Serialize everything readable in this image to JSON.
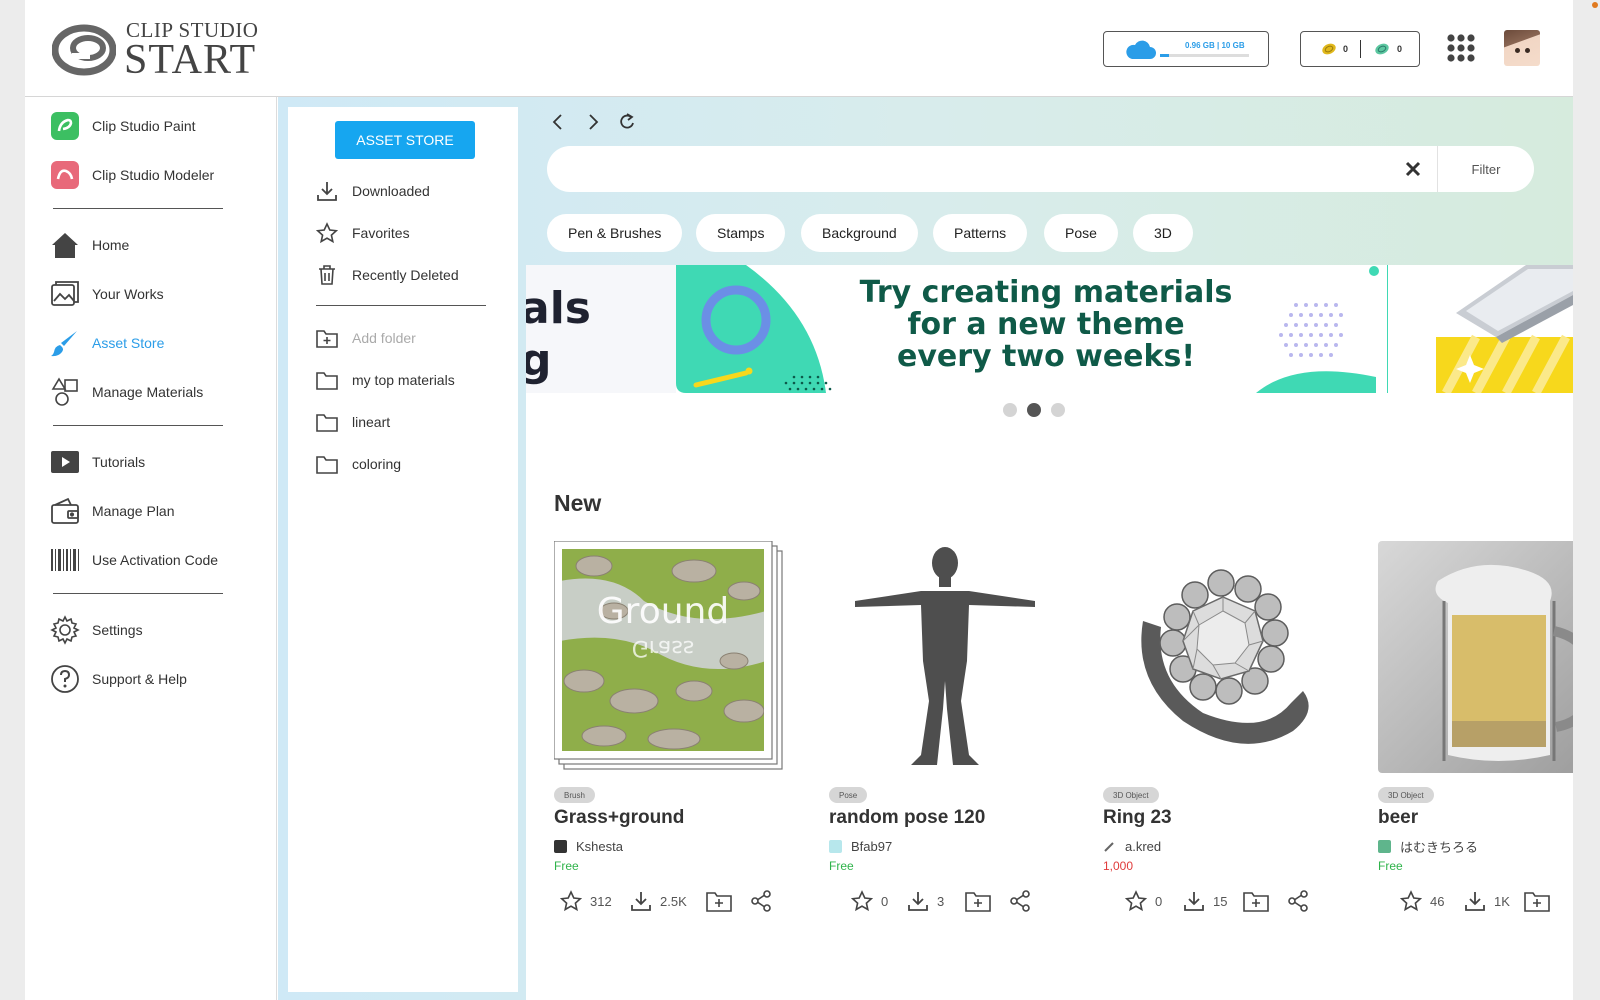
{
  "header": {
    "logo_top": "CLIP STUDIO",
    "logo_bottom": "START",
    "storage_text": "0.96 GB | 10 GB",
    "storage_fraction": 0.1,
    "gold_points": "0",
    "clippy_points": "0"
  },
  "sidebar": {
    "items": [
      {
        "label": "Clip Studio Paint",
        "icon": "paint-app-icon"
      },
      {
        "label": "Clip Studio Modeler",
        "icon": "modeler-app-icon"
      },
      {
        "label": "Home",
        "icon": "home-icon"
      },
      {
        "label": "Your Works",
        "icon": "works-icon"
      },
      {
        "label": "Asset Store",
        "icon": "brush-icon"
      },
      {
        "label": "Manage Materials",
        "icon": "shapes-icon"
      },
      {
        "label": "Tutorials",
        "icon": "play-icon"
      },
      {
        "label": "Manage Plan",
        "icon": "wallet-icon"
      },
      {
        "label": "Use Activation Code",
        "icon": "barcode-icon"
      },
      {
        "label": "Settings",
        "icon": "gear-icon"
      },
      {
        "label": "Support & Help",
        "icon": "help-icon"
      }
    ],
    "active": "Asset Store"
  },
  "subpanel": {
    "store_button": "ASSET STORE",
    "items": [
      {
        "label": "Downloaded",
        "icon": "download-icon"
      },
      {
        "label": "Favorites",
        "icon": "star-icon"
      },
      {
        "label": "Recently Deleted",
        "icon": "trash-icon"
      }
    ],
    "add_folder": "Add folder",
    "folders": [
      {
        "label": "my top materials"
      },
      {
        "label": "lineart"
      },
      {
        "label": "coloring"
      }
    ]
  },
  "search": {
    "placeholder": "",
    "filter_label": "Filter"
  },
  "categories": [
    "Pen & Brushes",
    "Stamps",
    "Background",
    "Patterns",
    "Pose",
    "3D"
  ],
  "banner": {
    "left_text_line1": "als",
    "left_text_line2": "g",
    "headline_line1": "Try creating materials",
    "headline_line2": "for a new theme",
    "headline_line3": "every two weeks!",
    "slides": 3,
    "active_slide": 2,
    "accent_colors": {
      "teal": "#3fd9b4",
      "dark_green": "#0f5a48",
      "yellow": "#f7d81c",
      "blue_ring": "#6b8fe6"
    }
  },
  "section": {
    "title": "New"
  },
  "cards": [
    {
      "tag": "Brush",
      "title": "Grass+ground",
      "author": "Kshesta",
      "price": "Free",
      "favorites": "312",
      "downloads": "2.5K"
    },
    {
      "tag": "Pose",
      "title": "random pose 120",
      "author": "Bfab97",
      "price": "Free",
      "favorites": "0",
      "downloads": "3"
    },
    {
      "tag": "3D Object",
      "title": "Ring 23",
      "author": "a.kred",
      "price": "1,000",
      "favorites": "0",
      "downloads": "15"
    },
    {
      "tag": "3D Object",
      "title": "beer",
      "author": "はむきちろる",
      "price": "Free",
      "favorites": "46",
      "downloads": "1K"
    }
  ],
  "colors": {
    "accent": "#16a6f0",
    "active_nav": "#2b9de8",
    "free_price": "#2fb34a",
    "paid_price": "#e03b3b"
  }
}
